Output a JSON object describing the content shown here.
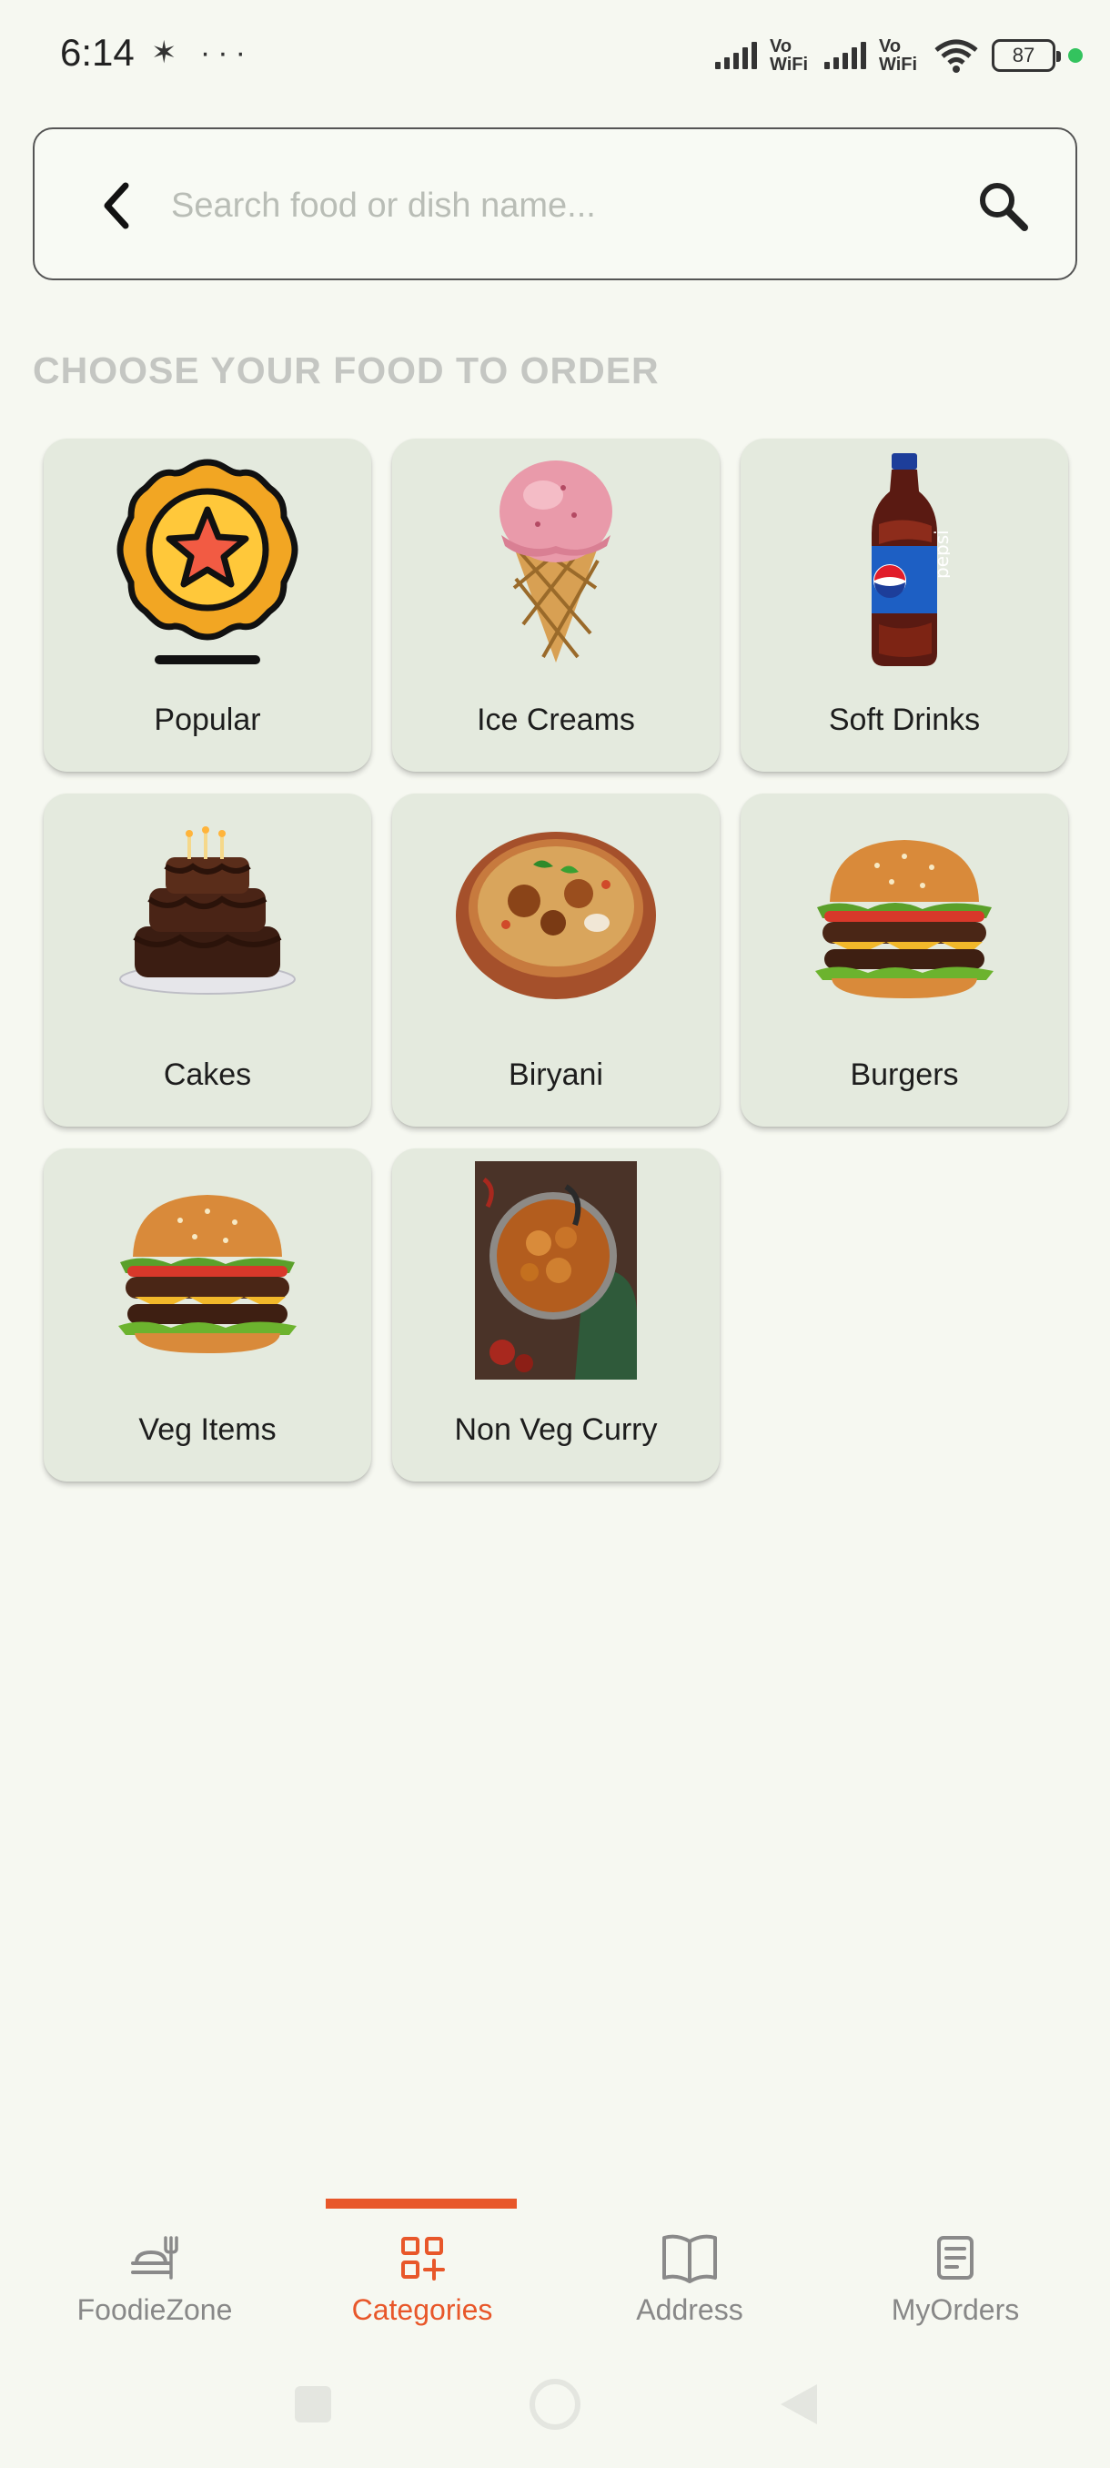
{
  "status_bar": {
    "time": "6:14",
    "extra_icons": "✶ ···",
    "network_label_1": "Vo WiFi",
    "network_label_2": "Vo WiFi",
    "battery": "87"
  },
  "search": {
    "placeholder": "Search food or dish name..."
  },
  "section_title": "CHOOSE YOUR FOOD TO ORDER",
  "categories": [
    {
      "label": "Popular",
      "icon": "star-badge-icon"
    },
    {
      "label": "Ice Creams",
      "icon": "ice-cream-cone-image"
    },
    {
      "label": "Soft Drinks",
      "icon": "soda-bottle-image"
    },
    {
      "label": "Cakes",
      "icon": "chocolate-cake-image"
    },
    {
      "label": "Biryani",
      "icon": "biryani-bowl-image"
    },
    {
      "label": "Burgers",
      "icon": "burger-image"
    },
    {
      "label": "Veg Items",
      "icon": "burger-image"
    },
    {
      "label": "Non Veg Curry",
      "icon": "curry-pot-image"
    }
  ],
  "bottom_nav": [
    {
      "label": "FoodieZone",
      "icon": "food-tray-icon",
      "active": false
    },
    {
      "label": "Categories",
      "icon": "grid-plus-icon",
      "active": true
    },
    {
      "label": "Address",
      "icon": "open-book-icon",
      "active": false
    },
    {
      "label": "MyOrders",
      "icon": "document-list-icon",
      "active": false
    }
  ],
  "colors": {
    "accent": "#e8572a",
    "background": "#f6f8f1",
    "card": "#e4eade"
  }
}
